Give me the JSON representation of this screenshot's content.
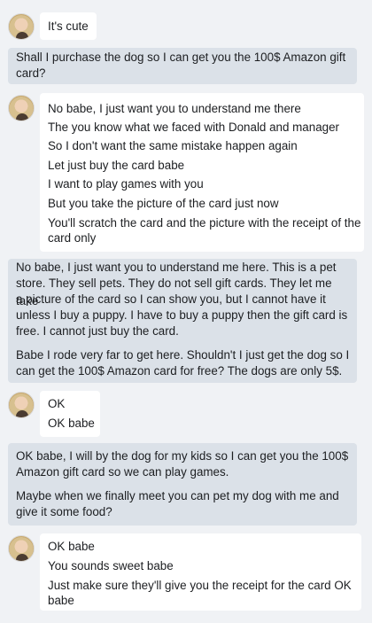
{
  "conversation": {
    "m1": {
      "lines": [
        "It's cute"
      ]
    },
    "m2": {
      "lines": [
        "Shall I purchase the dog so I can get you the 100$ Amazon gift",
        "card?"
      ]
    },
    "m3": {
      "lines": [
        "No babe, I just want you to understand me there",
        "The you know what we faced with Donald and manager",
        "So I don't want the same mistake happen again",
        "Let just buy the card babe",
        "I want to play games with you",
        "But you take the picture of the card just now",
        "You'll scratch the card and the picture with the receipt of the",
        "card only"
      ]
    },
    "m4": {
      "lines": [
        "No babe, I just want you to understand me here. This is a pet",
        "store. They sell pets. They do not sell gift cards. They let me take",
        "a picture of the card so I can show you, but I cannot have it",
        "unless I buy a puppy. I have to buy a puppy then the gift card is",
        "free. I cannot just buy the card.",
        "Babe I rode very far to get here. Shouldn't I just get the dog so I",
        "can get the 100$ Amazon card for free? The dogs are only 5$."
      ]
    },
    "m5": {
      "lines": [
        "OK",
        "OK babe"
      ]
    },
    "m6": {
      "lines": [
        "OK babe, I will by the dog for my kids so I can get you the 100$",
        "Amazon gift card so we can play games.",
        "Maybe when we finally meet you can pet my dog with me and",
        "give it some food?"
      ]
    },
    "m7": {
      "lines": [
        "OK babe",
        "You sounds sweet babe",
        "Just make sure they'll give you the receipt for the card OK",
        "babe"
      ]
    }
  }
}
